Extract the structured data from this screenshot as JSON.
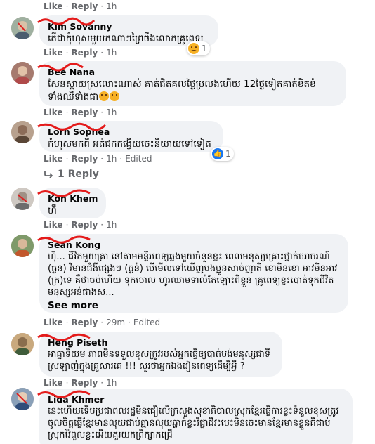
{
  "top_meta": {
    "like": "Like",
    "reply": "Reply",
    "time": "1h"
  },
  "comments": [
    {
      "name": "Kim Sovanny",
      "text": "តើជាកុំហុសមួយកណាៗព្រៃចឹងលោកគ្រូពេទ្យ",
      "like": "Like",
      "reply": "Reply",
      "time": "1h",
      "reaction": {
        "icon": "sad-emoji",
        "count": "1"
      }
    },
    {
      "name": "Bee Nana",
      "text": "សែនស្ដាយស្រលោះណាស់ គាត់ជិតគលថ្ងៃប្រលងហើយ 12ថ្ងៃទៀតគាត់ខិតខំទាំងឈឺទាំងជា",
      "like": "Like",
      "reply": "Reply",
      "time": "1h"
    },
    {
      "name": "Lorn Sophea",
      "text": "កំហុសមកពី អត់ជកកង្វើយចេះនិយាយទៅទៀត",
      "like": "Like",
      "reply": "Reply",
      "time": "1h",
      "edited": "Edited",
      "reaction": {
        "icon": "like-emoji",
        "count": "1"
      }
    },
    {
      "name": "Koh Khem",
      "text": "ហឹ",
      "like": "Like",
      "reply": "Reply",
      "time": "1h"
    },
    {
      "name": "Sean Kong",
      "text": "ហ៊ឹ... ជីវិតមួយគ្រា នៅតាមមន្ទីរពេទ្យឆ្លងមួយចំនួនខ្លះ ពេលមនុស្សគ្រោះថ្នាក់ចរាចរណ៍ (ធ្ងន់) វិមានជំងឺផ្សេងៗ (ធ្ងន់) បើមើលទៅឃើញបងប្អូនសាច់ញាតិ ខោមិនខោ អាវមិនអាវ (ក្រ)ទេ គឺថាចប់ហើយ ទុកចោល ហូរឈាមទាល់តែឡោះពីខ្លួន គ្រូពេទ្យខ្លះបោត់ទុកជីវិតមនុស្សអន់ជាងស...",
      "see_more": "See more",
      "like": "Like",
      "reply": "Reply",
      "time": "29m",
      "edited": "Edited"
    },
    {
      "name": "Heng Piseth",
      "text": "អាគ្នាទិយម ភាពមិនទទួលខុសត្រូវរបស់អ្នកធ្វើឲ្យបាត់បង់មនុស្សជាទីស្រឡាញ់ក្នុងគ្រួសារគេ !!! សួរថាអ្នកឯងរៀនពេទ្យដើម្បីអ្វី ?",
      "like": "Like",
      "reply": "Reply",
      "time": "1h"
    },
    {
      "name": "Lida Khmer",
      "text": "នេះហើយទើបប្រជាពលរដ្ឋមិនជឿលើក្រសួងសុខាភិបាលស្រុកខ្មែរធ្វើការខ្វះទំនួលខុសត្រូវចូលចិត្តធ្វើខ្មែរមានលុយជាប់គ្មានលុយឆ្លាក់ខ្វះវិជ្ជាជីវះបេះមិនចេះមានខ្មែរមានខ្លួនគីជាប់ស្រុកវ៉ៃពួលខ្លះអើយគួរយកព្រឹក្សាកជ្រើ"
    }
  ],
  "replies_link": {
    "icon": "reply-arrow-icon",
    "label": "1 Reply"
  }
}
